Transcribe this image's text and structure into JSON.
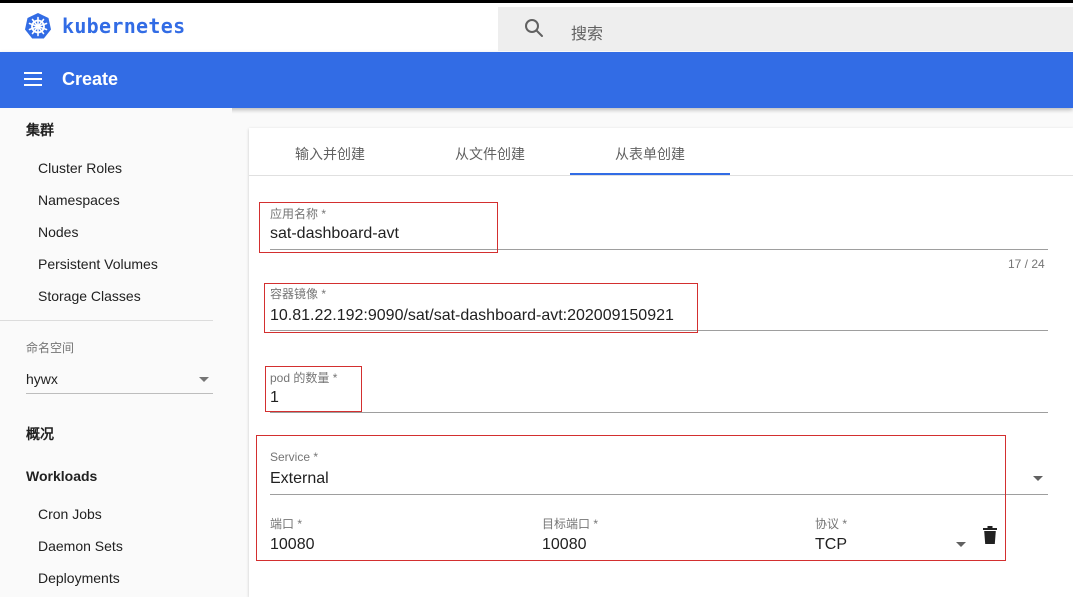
{
  "brand": {
    "name": "kubernetes",
    "color": "#326ce5"
  },
  "search": {
    "placeholder": "搜索"
  },
  "appbar": {
    "title": "Create"
  },
  "sidebar": {
    "cluster_heading": "集群",
    "cluster_items": [
      "Cluster Roles",
      "Namespaces",
      "Nodes",
      "Persistent Volumes",
      "Storage Classes"
    ],
    "namespace_label": "命名空间",
    "namespace_value": "hywx",
    "overview_heading": "概况",
    "workloads_heading": "Workloads",
    "workload_items": [
      "Cron Jobs",
      "Daemon Sets",
      "Deployments"
    ]
  },
  "tabs": [
    {
      "label": "输入并创建",
      "active": false
    },
    {
      "label": "从文件创建",
      "active": false
    },
    {
      "label": "从表单创建",
      "active": true
    }
  ],
  "form": {
    "app_name_label": "应用名称 *",
    "app_name_value": "sat-dashboard-avt",
    "app_name_counter": "17 / 24",
    "image_label": "容器镜像 *",
    "image_value": "10.81.22.192:9090/sat/sat-dashboard-avt:202009150921",
    "pods_label": "pod 的数量 *",
    "pods_value": "1",
    "service_label": "Service *",
    "service_value": "External",
    "port_label": "端口 *",
    "port_value": "10080",
    "target_port_label": "目标端口 *",
    "target_port_value": "10080",
    "protocol_label": "协议 *",
    "protocol_value": "TCP"
  },
  "colors": {
    "accent": "#326ce5",
    "highlight": "#d32f2f"
  },
  "icons": {
    "logo": "kubernetes-helm-icon",
    "search": "search-icon",
    "menu": "menu-icon",
    "delete": "trash-icon"
  }
}
